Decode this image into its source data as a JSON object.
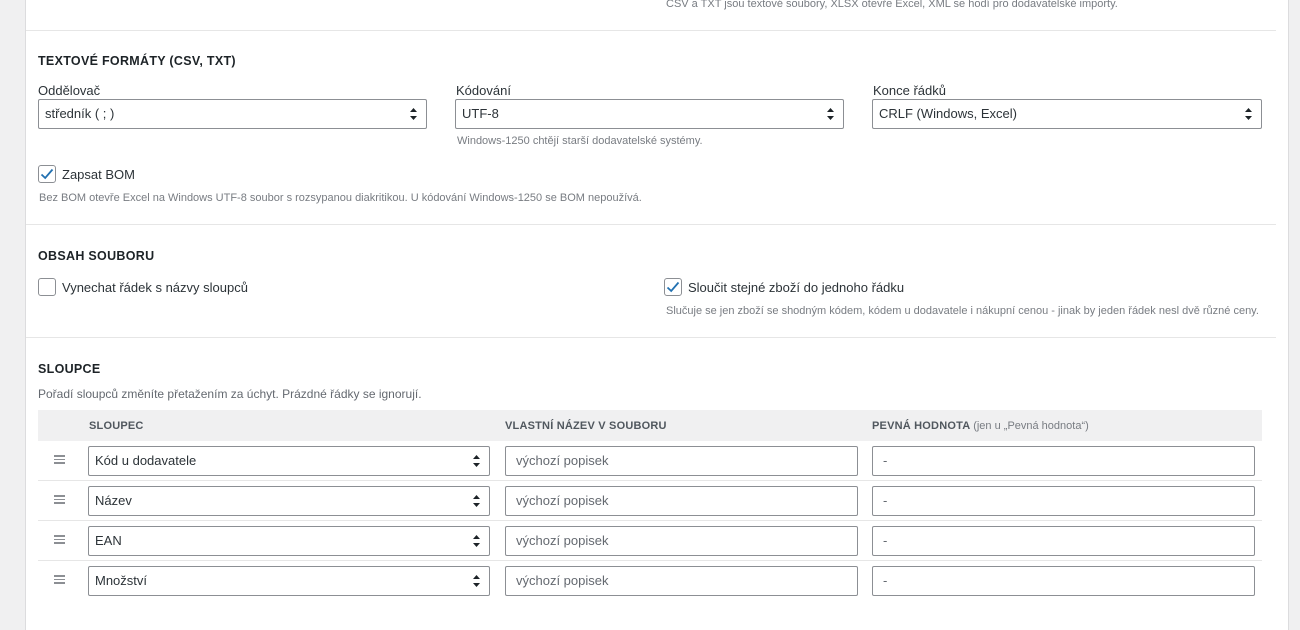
{
  "top_hint": "CSV a TXT jsou textové soubory, XLSX otevře Excel, XML se hodí pro dodavatelské importy.",
  "text_formats": {
    "title": "TEXTOVÉ FORMÁTY (CSV, TXT)",
    "separator": {
      "label": "Oddělovač",
      "value": "středník ( ; )"
    },
    "encoding": {
      "label": "Kódování",
      "value": "UTF-8",
      "hint": "Windows-1250 chtějí starší dodavatelské systémy."
    },
    "line_endings": {
      "label": "Konce řádků",
      "value": "CRLF (Windows, Excel)"
    },
    "bom": {
      "label": "Zapsat BOM",
      "checked": true,
      "hint": "Bez BOM otevře Excel na Windows UTF-8 soubor s rozsypanou diakritikou. U kódování Windows-1250 se BOM nepoužívá."
    }
  },
  "file_content": {
    "title": "OBSAH SOUBORU",
    "skip_header": {
      "label": "Vynechat řádek s názvy sloupců",
      "checked": false
    },
    "merge_items": {
      "label": "Sloučit stejné zboží do jednoho řádku",
      "checked": true,
      "hint": "Slučuje se jen zboží se shodným kódem, kódem u dodavatele i nákupní cenou - jinak by jeden řádek nesl dvě různé ceny."
    }
  },
  "columns": {
    "title": "SLOUPCE",
    "hint": "Pořadí sloupců změníte přetažením za úchyt. Prázdné řádky se ignorují.",
    "headers": {
      "column": "SLOUPEC",
      "custom_name": "VLASTNÍ NÁZEV V SOUBORU",
      "fixed_value": "PEVNÁ HODNOTA",
      "fixed_value_note": "(jen u „Pevná hodnota“)"
    },
    "rows": [
      {
        "column": "Kód u dodavatele",
        "custom_name_placeholder": "výchozí popisek",
        "fixed_value_placeholder": "-"
      },
      {
        "column": "Název",
        "custom_name_placeholder": "výchozí popisek",
        "fixed_value_placeholder": "-"
      },
      {
        "column": "EAN",
        "custom_name_placeholder": "výchozí popisek",
        "fixed_value_placeholder": "-"
      },
      {
        "column": "Množství",
        "custom_name_placeholder": "výchozí popisek",
        "fixed_value_placeholder": "-"
      }
    ]
  },
  "icons": {
    "select_arrows": "up-down-arrows-icon",
    "drag_handle": "drag-handle-icon",
    "checkmark": "checkmark-icon"
  },
  "colors": {
    "checkbox_check": "#2271b1",
    "border": "#8c8f94",
    "background": "#f0f0f1"
  }
}
